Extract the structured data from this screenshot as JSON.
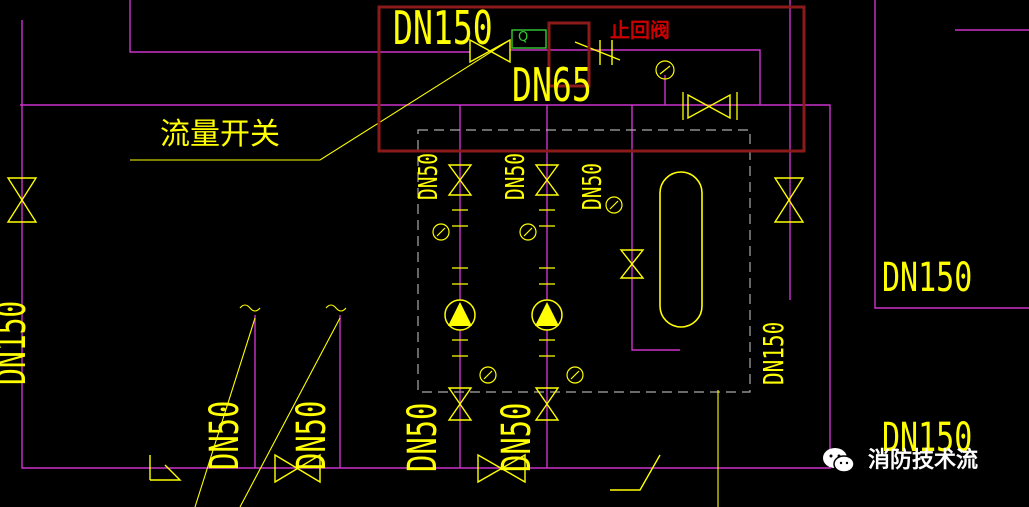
{
  "labels": {
    "dn150_top": "DN150",
    "dn65": "DN65",
    "check_valve": "止回阀",
    "flow_switch": "流量开关",
    "dn150_right1": "DN150",
    "dn150_right2": "DN150",
    "dn150_vert_right": "DN150",
    "dn150_vert_left": "DN150",
    "dn50_top_a": "DN50",
    "dn50_top_b": "DN50",
    "dn50_top_c": "DN50",
    "dn50_left_a": "DN50",
    "dn50_left_b": "DN50",
    "dn50_bottom_a": "DN50",
    "dn50_bottom_b": "DN50",
    "flow_switch_box": "Q"
  },
  "watermark": {
    "text": "消防技术流",
    "icon": "wechat-icon"
  },
  "colors": {
    "background": "#000000",
    "pipe": "#cc33cc",
    "annotation": "#ffff00",
    "highlight": "#8b1a1a",
    "valve": "#ffff00",
    "pump": "#ffff00",
    "flow_switch": "#33cc33",
    "watermark": "#ffffff"
  }
}
